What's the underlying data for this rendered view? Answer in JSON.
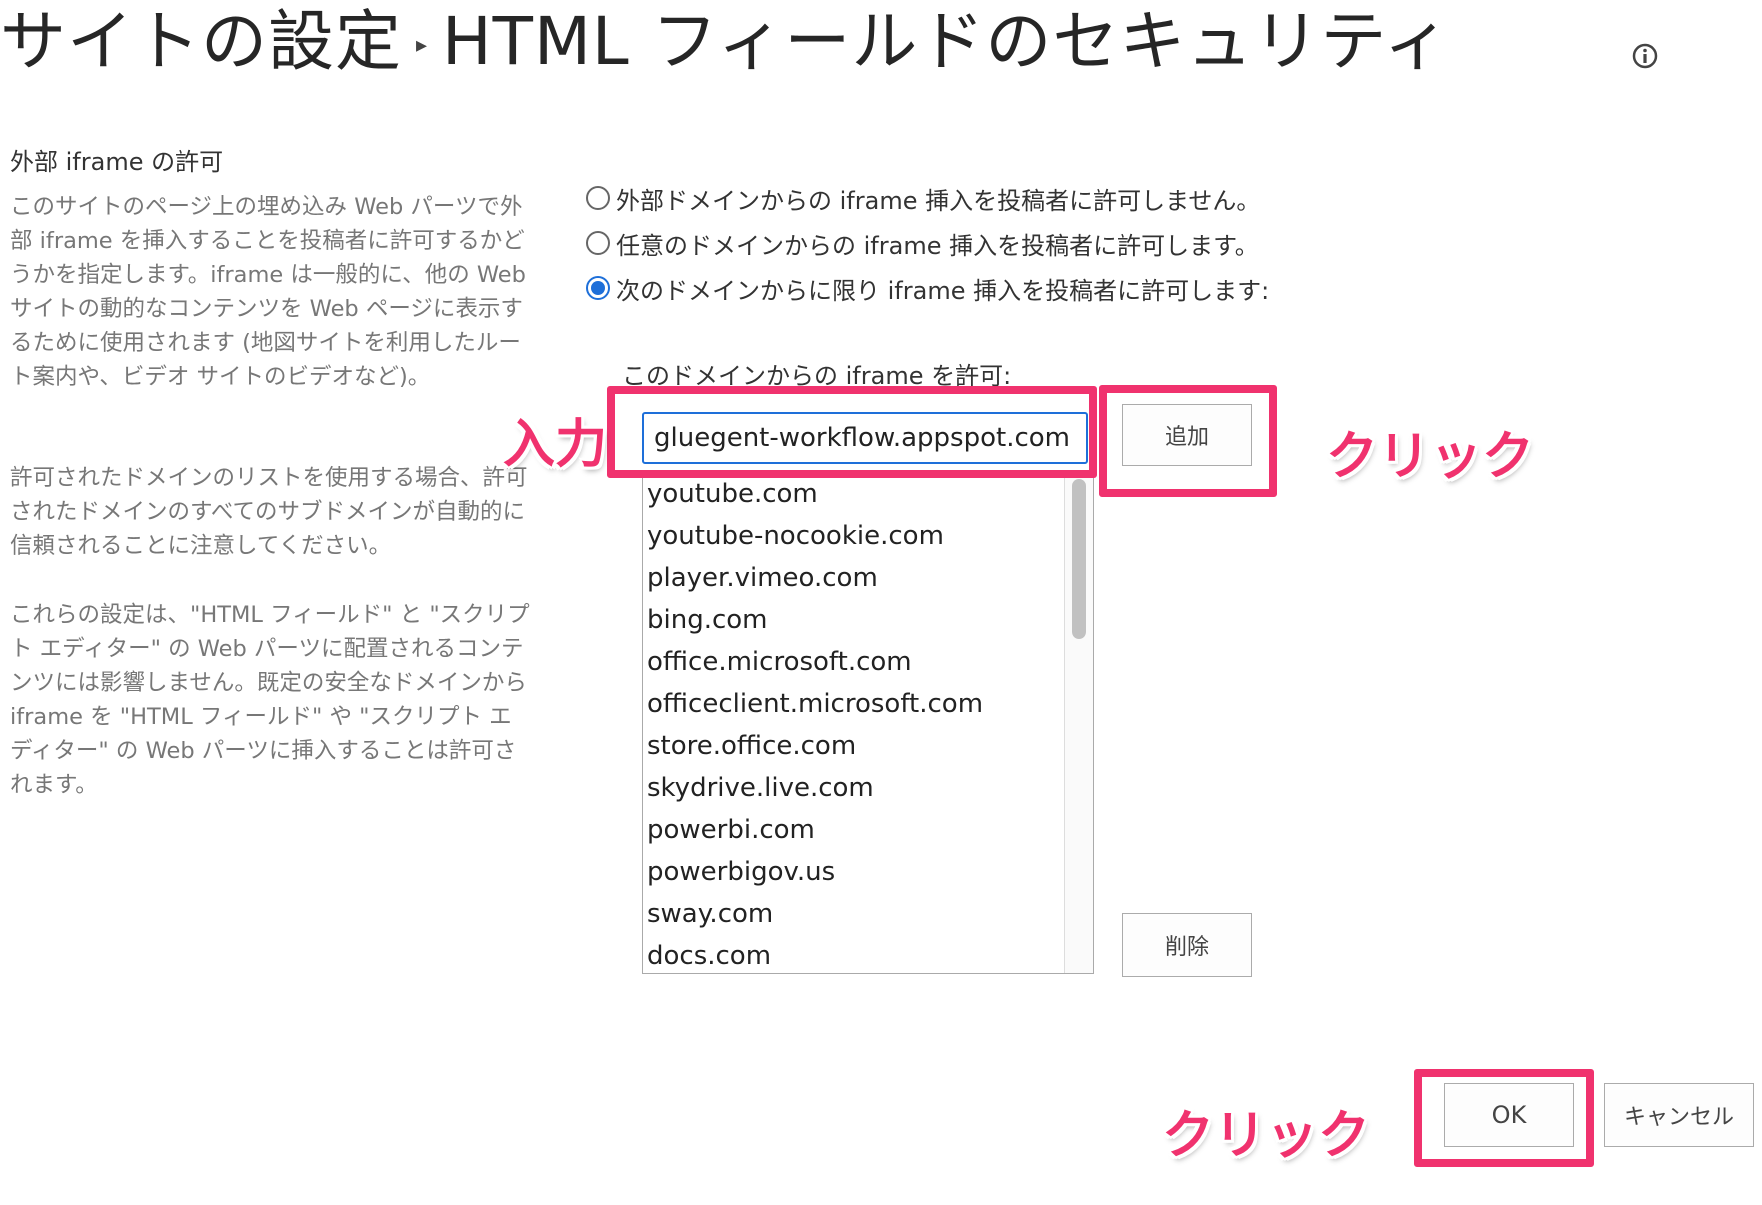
{
  "header": {
    "title_prefix": "サイトの設定",
    "separator": "▸",
    "title": "HTML フィールドのセキュリティ",
    "info_icon": "info-circle-icon"
  },
  "section": {
    "heading": "外部 iframe の許可",
    "description_1": "このサイトのページ上の埋め込み Web パーツで外部 iframe を挿入することを投稿者に許可するかどうかを指定します。iframe は一般的に、他の Web サイトの動的なコンテンツを Web ページに表示するために使用されます (地図サイトを利用したルート案内や、ビデオ サイトのビデオなど)。",
    "description_2": "許可されたドメインのリストを使用する場合、許可されたドメインのすべてのサブドメインが自動的に信頼されることに注意してください。",
    "description_3": "これらの設定は、\"HTML フィールド\" と \"スクリプト エディター\" の Web パーツに配置されるコンテンツには影響しません。既定の安全なドメインから iframe を \"HTML フィールド\" や \"スクリプト エディター\" の Web パーツに挿入することは許可されます。"
  },
  "options": [
    {
      "label": "外部ドメインからの iframe 挿入を投稿者に許可しません。",
      "checked": false
    },
    {
      "label": "任意のドメインからの iframe 挿入を投稿者に許可します。",
      "checked": false
    },
    {
      "label": "次のドメインからに限り iframe 挿入を投稿者に許可します:",
      "checked": true
    }
  ],
  "allow": {
    "label": "このドメインからの iframe を許可:",
    "input_value": "gluegent-workflow.appspot.com",
    "add_button": "追加",
    "delete_button": "削除",
    "domains": [
      "youtube.com",
      "youtube-nocookie.com",
      "player.vimeo.com",
      "bing.com",
      "office.microsoft.com",
      "officeclient.microsoft.com",
      "store.office.com",
      "skydrive.live.com",
      "powerbi.com",
      "powerbigov.us",
      "sway.com",
      "docs.com"
    ]
  },
  "footer": {
    "ok_button": "OK",
    "cancel_button": "キャンセル"
  },
  "annotations": {
    "input": "入力",
    "click_add": "クリック",
    "click_ok": "クリック",
    "highlight_color": "#f0326e"
  },
  "colors": {
    "accent": "#1e6fd9",
    "highlight": "#f0326e"
  }
}
